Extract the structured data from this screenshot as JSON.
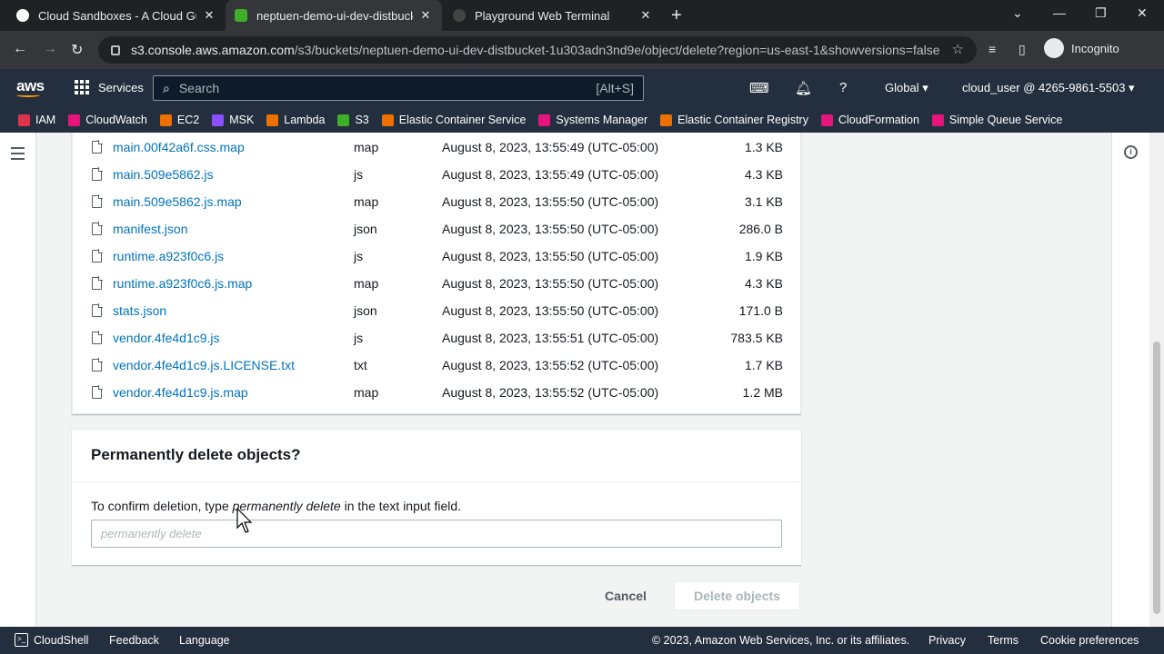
{
  "browser": {
    "tabs": [
      {
        "title": "Cloud Sandboxes - A Cloud Guru",
        "color": "#ff6b35"
      },
      {
        "title": "neptuen-demo-ui-dev-distbucke",
        "color": "#3fae29"
      },
      {
        "title": "Playground Web Terminal",
        "color": "#444444"
      }
    ],
    "url_host": "s3.console.aws.amazon.com",
    "url_path": "/s3/buckets/neptuen-demo-ui-dev-distbucket-1u303adn3nd9e/object/delete?region=us-east-1&showversions=false",
    "profile": "Incognito"
  },
  "aws_nav": {
    "services": "Services",
    "search_placeholder": "Search",
    "search_shortcut": "[Alt+S]",
    "region": "Global",
    "account": "cloud_user @ 4265-9861-5503"
  },
  "favorites": [
    {
      "label": "IAM",
      "color": "#dd344c"
    },
    {
      "label": "CloudWatch",
      "color": "#e7157b"
    },
    {
      "label": "EC2",
      "color": "#ed7100"
    },
    {
      "label": "MSK",
      "color": "#8c4fff"
    },
    {
      "label": "Lambda",
      "color": "#ed7100"
    },
    {
      "label": "S3",
      "color": "#3fae29"
    },
    {
      "label": "Elastic Container Service",
      "color": "#ed7100"
    },
    {
      "label": "Systems Manager",
      "color": "#e7157b"
    },
    {
      "label": "Elastic Container Registry",
      "color": "#ed7100"
    },
    {
      "label": "CloudFormation",
      "color": "#e7157b"
    },
    {
      "label": "Simple Queue Service",
      "color": "#e7157b"
    }
  ],
  "objects": [
    {
      "name": "main.00f42a6f.css.map",
      "type": "map",
      "date": "August 8, 2023, 13:55:49 (UTC-05:00)",
      "size": "1.3 KB"
    },
    {
      "name": "main.509e5862.js",
      "type": "js",
      "date": "August 8, 2023, 13:55:49 (UTC-05:00)",
      "size": "4.3 KB"
    },
    {
      "name": "main.509e5862.js.map",
      "type": "map",
      "date": "August 8, 2023, 13:55:50 (UTC-05:00)",
      "size": "3.1 KB"
    },
    {
      "name": "manifest.json",
      "type": "json",
      "date": "August 8, 2023, 13:55:50 (UTC-05:00)",
      "size": "286.0 B"
    },
    {
      "name": "runtime.a923f0c6.js",
      "type": "js",
      "date": "August 8, 2023, 13:55:50 (UTC-05:00)",
      "size": "1.9 KB"
    },
    {
      "name": "runtime.a923f0c6.js.map",
      "type": "map",
      "date": "August 8, 2023, 13:55:50 (UTC-05:00)",
      "size": "4.3 KB"
    },
    {
      "name": "stats.json",
      "type": "json",
      "date": "August 8, 2023, 13:55:50 (UTC-05:00)",
      "size": "171.0 B"
    },
    {
      "name": "vendor.4fe4d1c9.js",
      "type": "js",
      "date": "August 8, 2023, 13:55:51 (UTC-05:00)",
      "size": "783.5 KB"
    },
    {
      "name": "vendor.4fe4d1c9.js.LICENSE.txt",
      "type": "txt",
      "date": "August 8, 2023, 13:55:52 (UTC-05:00)",
      "size": "1.7 KB"
    },
    {
      "name": "vendor.4fe4d1c9.js.map",
      "type": "map",
      "date": "August 8, 2023, 13:55:52 (UTC-05:00)",
      "size": "1.2 MB"
    }
  ],
  "delete_panel": {
    "heading": "Permanently delete objects?",
    "instr_prefix": "To confirm deletion, type ",
    "instr_phrase": "permanently delete",
    "instr_suffix": " in the text input field.",
    "input_placeholder": "permanently delete",
    "input_value": "",
    "cancel": "Cancel",
    "delete": "Delete objects"
  },
  "footer": {
    "cloudshell": "CloudShell",
    "feedback": "Feedback",
    "language": "Language",
    "copyright": "© 2023, Amazon Web Services, Inc. or its affiliates.",
    "privacy": "Privacy",
    "terms": "Terms",
    "cookies": "Cookie preferences"
  }
}
